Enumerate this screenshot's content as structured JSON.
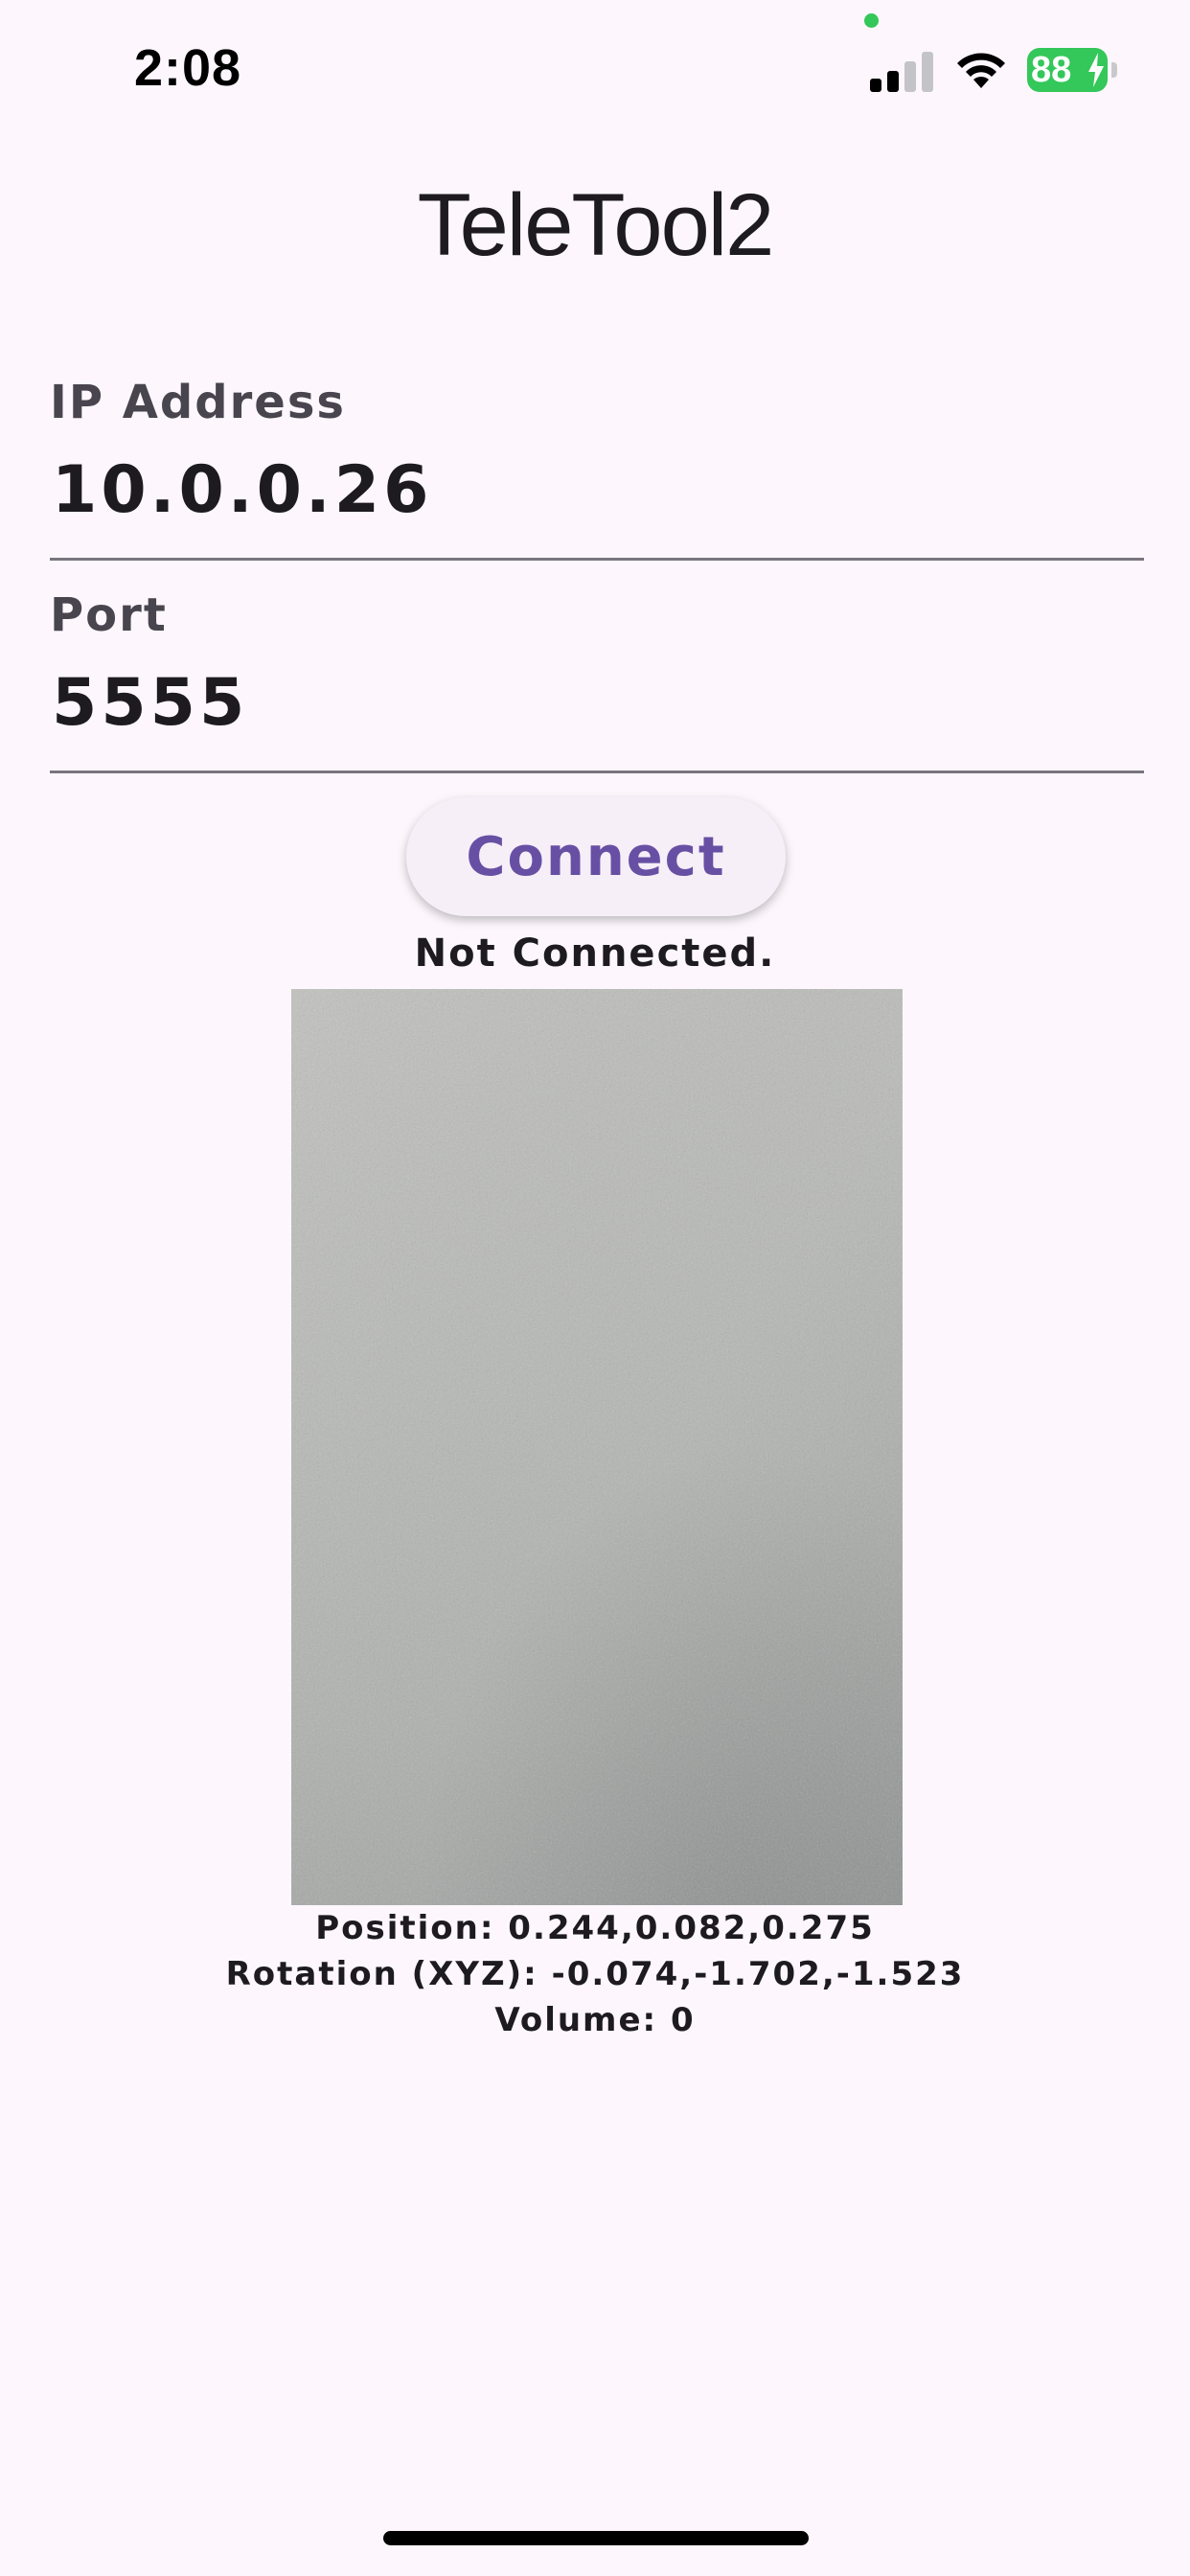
{
  "status_bar": {
    "time": "2:08",
    "battery_level": "88",
    "battery_charging": true,
    "privacy_dot_color": "#34c759",
    "battery_color": "#34c759",
    "signal_bars_active": 2,
    "signal_bars_total": 4
  },
  "app": {
    "title": "TeleTool2"
  },
  "ip_field": {
    "label": "IP Address",
    "value": "10.0.0.26"
  },
  "port_field": {
    "label": "Port",
    "value": "5555"
  },
  "connect_button": {
    "label": "Connect"
  },
  "connection": {
    "status": "Not Connected."
  },
  "readouts": {
    "position": "Position: 0.244,0.082,0.275",
    "rotation": "Rotation (XYZ): -0.074,-1.702,-1.523",
    "volume": "Volume: 0"
  },
  "colors": {
    "background": "#fdf7fd",
    "accent": "#6750a4",
    "label": "#49454f",
    "underline": "#79747e"
  }
}
